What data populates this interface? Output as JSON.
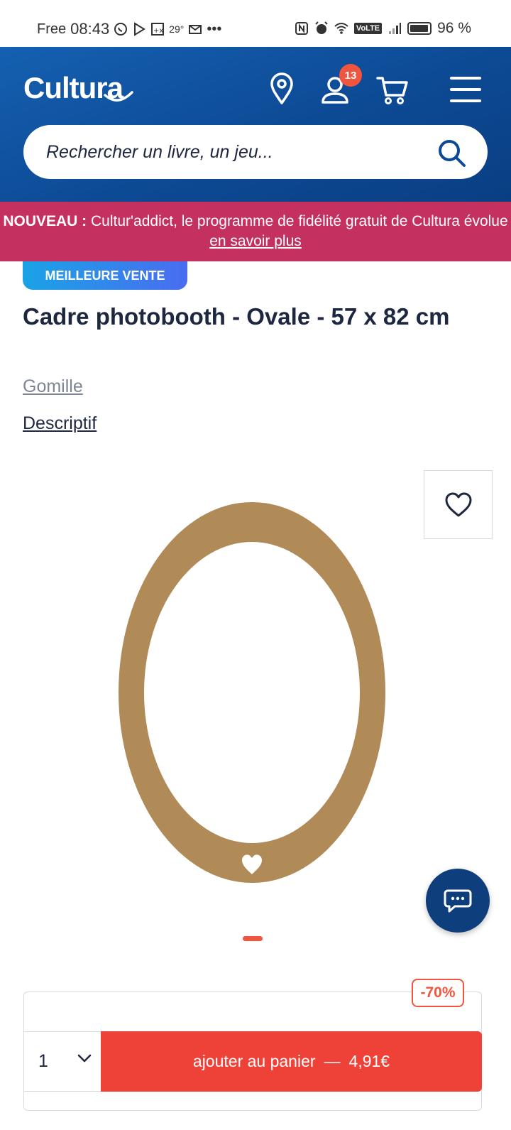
{
  "status_bar": {
    "carrier": "Free",
    "time": "08:43",
    "temperature": "29°",
    "network_badge": "VoLTE",
    "battery": "96 %"
  },
  "header": {
    "logo_text": "Cultura",
    "notification_count": "13",
    "search_placeholder": "Rechercher un livre, un jeu..."
  },
  "promo": {
    "bold_prefix": "NOUVEAU :",
    "text": " Cultur'addict, le programme de fidélité gratuit de Cultura évolue ",
    "link_text": "en savoir plus"
  },
  "product": {
    "tag": "MEILLEURE VENTE",
    "title": "Cadre photobooth - Ovale - 57 x 82 cm",
    "brand": "Gomille",
    "description_link": "Descriptif"
  },
  "purchase": {
    "discount": "-70%",
    "quantity": "1",
    "add_label": "ajouter au panier",
    "separator": "—",
    "price": "4,91€"
  },
  "colors": {
    "header_blue": "#0d4a95",
    "promo_pink": "#c4305f",
    "accent_orange": "#f2553d",
    "cta_red": "#ee4138",
    "frame_kraft": "#b08a57"
  }
}
